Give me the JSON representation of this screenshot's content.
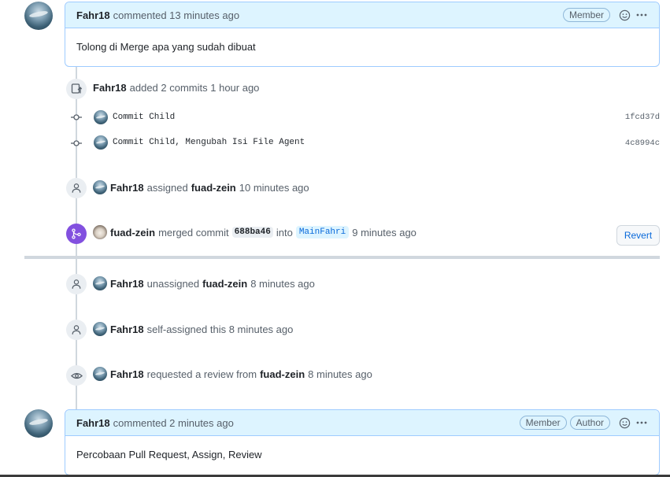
{
  "comment1": {
    "author": "Fahr18",
    "action": "commented 13 minutes ago",
    "badges": [
      "Member"
    ],
    "body": "Tolong di Merge apa yang sudah dibuat"
  },
  "commits_event": {
    "author": "Fahr18",
    "action": "added 2 commits 1 hour ago",
    "commits": [
      {
        "message": "Commit Child",
        "sha": "1fcd37d"
      },
      {
        "message": "Commit Child, Mengubah Isi File Agent",
        "sha": "4c8994c"
      }
    ]
  },
  "assign_event": {
    "actor": "Fahr18",
    "verb": "assigned",
    "target": "fuad-zein",
    "time": "10 minutes ago"
  },
  "merge_event": {
    "actor": "fuad-zein",
    "verb": "merged commit",
    "commit": "688ba46",
    "into": "into",
    "branch": "MainFahri",
    "time": "9 minutes ago",
    "revert_label": "Revert"
  },
  "unassign_event": {
    "actor": "Fahr18",
    "verb": "unassigned",
    "target": "fuad-zein",
    "time": "8 minutes ago"
  },
  "selfassign_event": {
    "actor": "Fahr18",
    "verb": "self-assigned this 8 minutes ago"
  },
  "review_event": {
    "actor": "Fahr18",
    "verb": "requested a review from",
    "target": "fuad-zein",
    "time": "8 minutes ago"
  },
  "comment2": {
    "author": "Fahr18",
    "action": "commented 2 minutes ago",
    "badges": [
      "Member",
      "Author"
    ],
    "body": "Percobaan Pull Request, Assign, Review"
  },
  "colors": {
    "accent": "#0969da",
    "merged": "#8250df",
    "comment_header": "#ddf4ff"
  },
  "icons": [
    "smiley-icon",
    "kebab-icon",
    "push-icon",
    "commit-icon",
    "person-icon",
    "merge-icon",
    "eye-icon"
  ]
}
